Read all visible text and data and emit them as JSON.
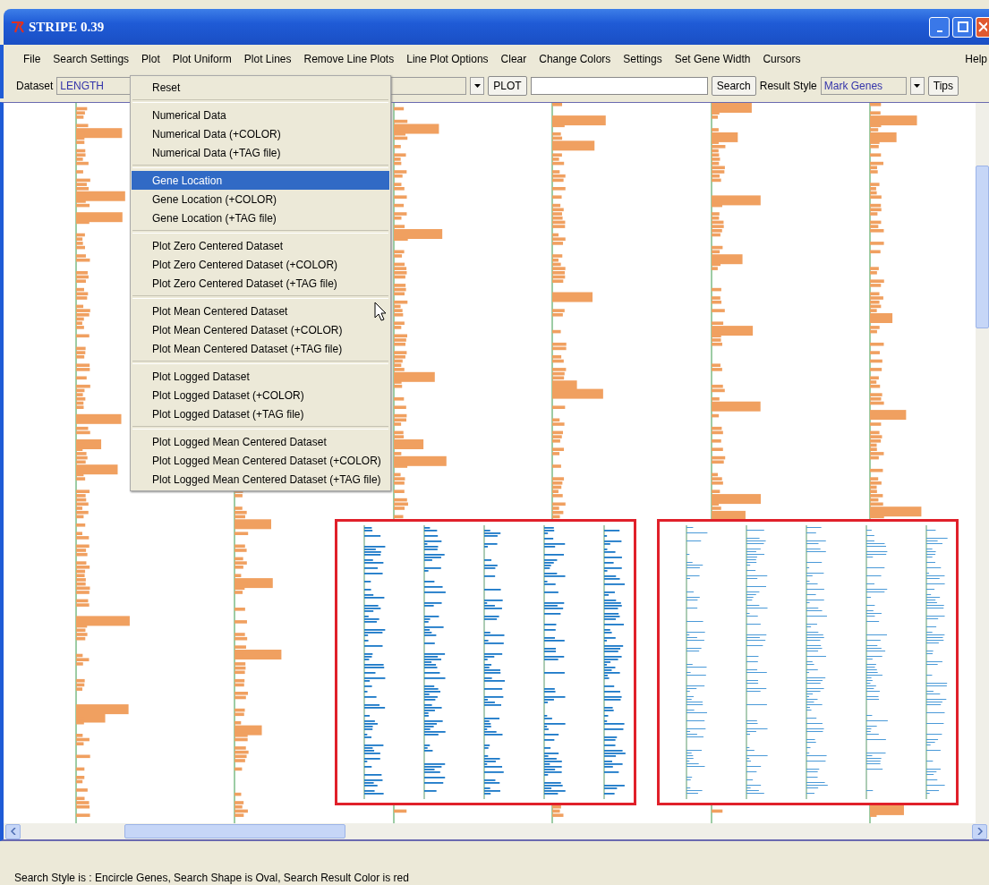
{
  "window": {
    "title": "STRIPE 0.39"
  },
  "menubar": {
    "items": [
      "File",
      "Search Settings",
      "Plot",
      "Plot Uniform",
      "Plot Lines",
      "Remove Line Plots",
      "Line Plot Options",
      "Clear",
      "Change Colors",
      "Settings",
      "Set Gene Width",
      "Cursors"
    ],
    "help": "Help"
  },
  "toolbar": {
    "dataset_label": "Dataset",
    "dataset_value": "LENGTH",
    "plot_button": "PLOT",
    "search_button": "Search",
    "result_style_label": "Result Style",
    "result_style_value": "Mark Genes",
    "tips_button": "Tips"
  },
  "plot_menu": {
    "groups": [
      [
        {
          "label": "Reset",
          "selected": false
        }
      ],
      [
        {
          "label": "Numerical Data",
          "selected": false
        },
        {
          "label": "Numerical Data (+COLOR)",
          "selected": false
        },
        {
          "label": "Numerical Data (+TAG file)",
          "selected": false
        }
      ],
      [
        {
          "label": "Gene Location",
          "selected": true
        },
        {
          "label": "Gene Location (+COLOR)",
          "selected": false
        },
        {
          "label": "Gene Location (+TAG file)",
          "selected": false
        }
      ],
      [
        {
          "label": "Plot Zero Centered Dataset",
          "selected": false
        },
        {
          "label": "Plot Zero Centered Dataset (+COLOR)",
          "selected": false
        },
        {
          "label": "Plot Zero Centered Dataset (+TAG file)",
          "selected": false
        }
      ],
      [
        {
          "label": "Plot Mean Centered Dataset",
          "selected": false
        },
        {
          "label": "Plot Mean Centered Dataset (+COLOR)",
          "selected": false
        },
        {
          "label": "Plot Mean Centered Dataset (+TAG file)",
          "selected": false
        }
      ],
      [
        {
          "label": "Plot Logged Dataset",
          "selected": false
        },
        {
          "label": "Plot Logged Dataset (+COLOR)",
          "selected": false
        },
        {
          "label": "Plot Logged Dataset (+TAG file)",
          "selected": false
        }
      ],
      [
        {
          "label": "Plot Logged Mean Centered Dataset",
          "selected": false
        },
        {
          "label": "Plot Logged Mean Centered Dataset (+COLOR)",
          "selected": false
        },
        {
          "label": "Plot Logged Mean Centered Dataset (+TAG file)",
          "selected": false
        }
      ]
    ]
  },
  "status_bar": {
    "text": "Search Style is : Encircle Genes, Search Shape is Oval, Search Result Color is red"
  }
}
